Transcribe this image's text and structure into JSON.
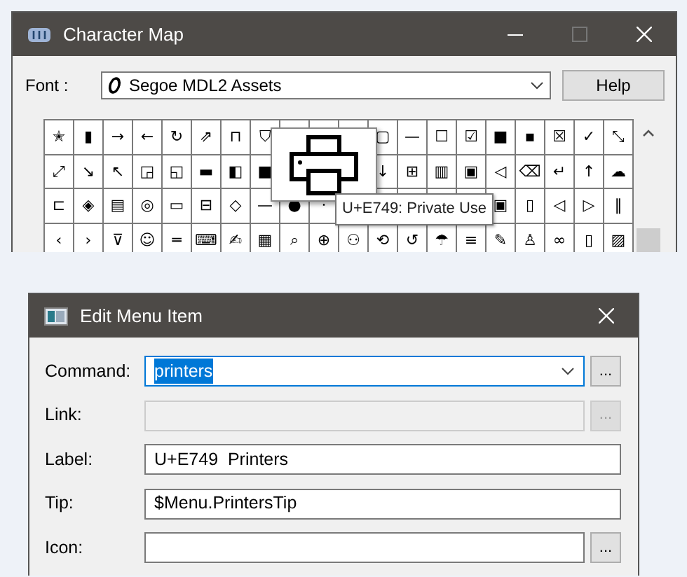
{
  "character_map": {
    "title": "Character Map",
    "font_label": "Font :",
    "font": "Segoe MDL2 Assets",
    "help_button": "Help",
    "grid": [
      {
        "left": [
          "✭",
          "▮",
          "→",
          "←",
          "↻",
          "⇗",
          "⊓",
          "⛉"
        ],
        "right": [
          "▢",
          "—",
          "☐",
          "☑",
          "■",
          "▪",
          "☒",
          "✓",
          "⤡"
        ]
      },
      {
        "left": [
          "⤢",
          "↘",
          "↖",
          "◲",
          "◱",
          "▬",
          "◧",
          "■"
        ],
        "right": [
          "↓",
          "⊞",
          "▥",
          "▣",
          "◁",
          "⌫",
          "↵",
          "↑",
          "☁"
        ]
      },
      {
        "left": [
          "⊏",
          "◈",
          "▤",
          "◎",
          "▭",
          "⊟",
          "◇",
          "—",
          "●",
          "·"
        ],
        "right": [
          "▣",
          "▯",
          "◁",
          "▷",
          "‖"
        ]
      },
      {
        "left": [
          "‹",
          "›",
          "⊽",
          "☺",
          "═",
          "⌨",
          "✍",
          "▦",
          "⌕",
          "⊕",
          "⚇",
          "⟲",
          "↺",
          "☂",
          "≡",
          "✎",
          "♙",
          "∞",
          "▯",
          "▨"
        ]
      }
    ],
    "tooltip": "U+E749: Private Use"
  },
  "edit_menu_item": {
    "title": "Edit Menu Item",
    "fields": [
      {
        "label": "Command:",
        "kind": "combo",
        "value": "printers",
        "focused": true,
        "disabled": false,
        "browse": "..."
      },
      {
        "label": "Link:",
        "kind": "text",
        "disabled": true,
        "browse": "..."
      },
      {
        "label": "Label:",
        "kind": "text",
        "value": "U+E749  Printers",
        "disabled": false
      },
      {
        "label": "Tip:",
        "kind": "text",
        "value": "$Menu.PrintersTip",
        "disabled": false
      },
      {
        "label": "Icon:",
        "kind": "text",
        "disabled": false,
        "browse": "..."
      }
    ]
  }
}
